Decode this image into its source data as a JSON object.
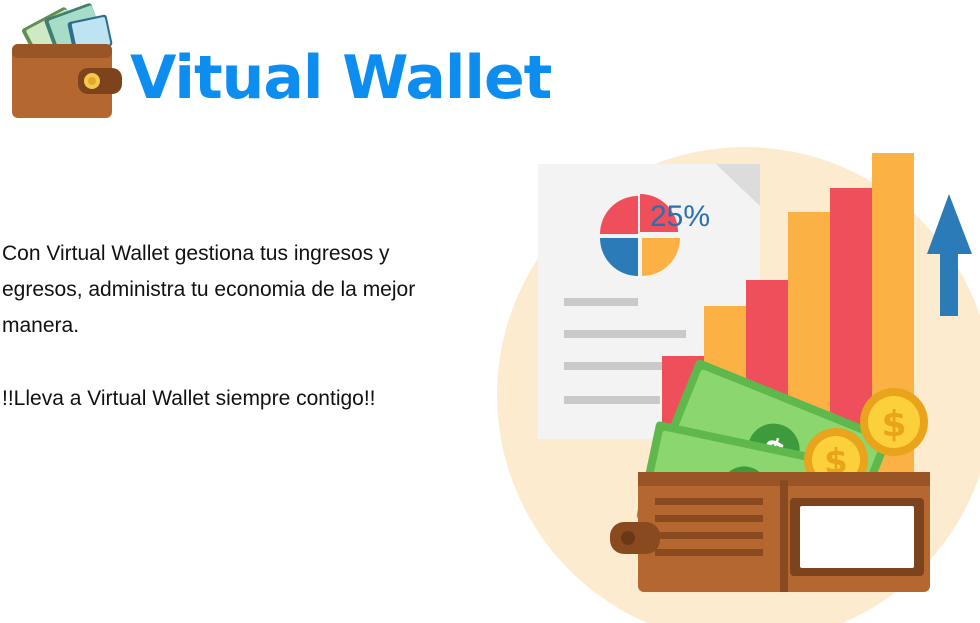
{
  "brand": {
    "title": "Vitual Wallet"
  },
  "intro": {
    "description": "Con Virtual Wallet gestiona tus ingresos y egresos, administra tu economia de la mejor manera.",
    "tagline": "!!Lleva a Virtual Wallet siempre contigo!!"
  },
  "illustration": {
    "percent_label": "25%",
    "coin_symbol": "$",
    "bill_symbol": "$"
  },
  "colors": {
    "brand_blue": "#0d8df0",
    "wallet_brown": "#b4682f",
    "money_green": "#6fca5a",
    "bar_orange": "#fbb144",
    "bar_red": "#ee4f5a",
    "arrow_blue": "#2a7bb8",
    "backdrop": "#fdebd0"
  },
  "icons": [
    "wallet-logo-icon",
    "pie-chart-icon",
    "growth-arrow-icon",
    "coin-icon",
    "banknote-icon"
  ]
}
